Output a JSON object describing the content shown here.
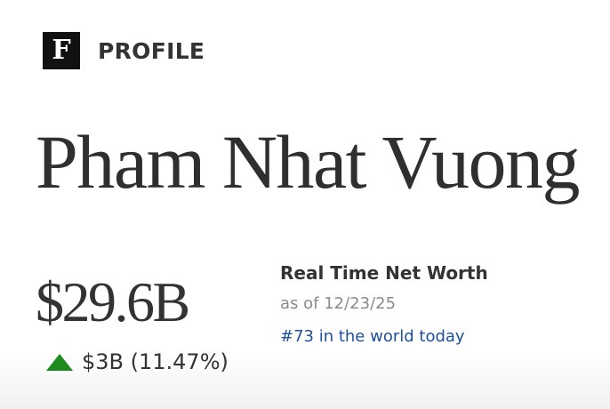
{
  "header": {
    "logo_letter": "F",
    "section_label": "PROFILE"
  },
  "profile": {
    "name": "Pham Nhat Vuong",
    "net_worth": "$29.6B",
    "change": {
      "direction": "up",
      "text": "$3B (11.47%)",
      "color": "#1c8a1c"
    },
    "real_time": {
      "title": "Real Time Net Worth",
      "as_of": "as of 12/23/25",
      "rank_text": "#73 in the world today",
      "rank_color": "#1f4f9a"
    }
  }
}
